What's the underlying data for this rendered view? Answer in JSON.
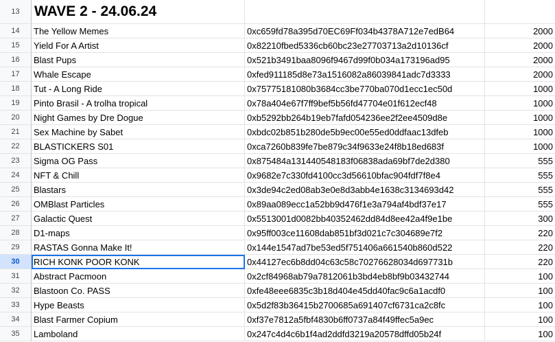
{
  "header": {
    "row_number": "13",
    "title": "WAVE 2 - 24.06.24"
  },
  "selection": {
    "active_row_number": "30"
  },
  "rows": [
    {
      "n": "14",
      "name": "The Yellow Memes",
      "address": "0xc659fd78a395d70EC69Ff034b4378A712e7edB64",
      "amount": "2000"
    },
    {
      "n": "15",
      "name": "Yield For A Artist",
      "address": "0x82210fbed5336cb60bc23e27703713a2d10136cf",
      "amount": "2000"
    },
    {
      "n": "16",
      "name": "Blast Pups",
      "address": "0x521b3491baa8096f9467d99f0b034a173196ad95",
      "amount": "2000"
    },
    {
      "n": "17",
      "name": "Whale Escape",
      "address": "0xfed911185d8e73a1516082a86039841adc7d3333",
      "amount": "2000"
    },
    {
      "n": "18",
      "name": "Tut - A Long Ride",
      "address": "0x75775181080b3684cc3be770ba070d1ecc1ec50d",
      "amount": "1000"
    },
    {
      "n": "19",
      "name": "Pinto Brasil - A trolha tropical",
      "address": "0x78a404e67f7ff9bef5b56fd47704e01f612ecf48",
      "amount": "1000"
    },
    {
      "n": "20",
      "name": "Night Games by Dre Dogue",
      "address": "0xb5292bb264b19eb7fafd054236ee2f2ee4509d8e",
      "amount": "1000"
    },
    {
      "n": "21",
      "name": "Sex Machine by Sabet",
      "address": "0xbdc02b851b280de5b9ec00e55ed0ddfaac13dfeb",
      "amount": "1000"
    },
    {
      "n": "22",
      "name": "BLASTICKERS S01",
      "address": "0xca7260b839fe7be879c34f9633e24f8b18ed683f",
      "amount": "1000"
    },
    {
      "n": "23",
      "name": "Sigma OG Pass",
      "address": "0x875484a131440548183f06838ada69bf7de2d380",
      "amount": "555"
    },
    {
      "n": "24",
      "name": "NFT & Chill",
      "address": "0x9682e7c330fd4100cc3d56610bfac904fdf7f8e4",
      "amount": "555"
    },
    {
      "n": "25",
      "name": "Blastars",
      "address": "0x3de94c2ed08ab3e0e8d3abb4e1638c3134693d42",
      "amount": "555"
    },
    {
      "n": "26",
      "name": "OMBlast Particles",
      "address": "0x89aa089ecc1a52bb9d476f1e3a794af4bdf37e17",
      "amount": "555"
    },
    {
      "n": "27",
      "name": "Galactic Quest",
      "address": "0x5513001d0082bb40352462dd84d8ee42a4f9e1be",
      "amount": "300"
    },
    {
      "n": "28",
      "name": "D1-maps",
      "address": "0x95ff003ce11608dab851bf3d021c7c304689e7f2",
      "amount": "220"
    },
    {
      "n": "29",
      "name": "RASTAS Gonna Make It!",
      "address": "0x144e1547ad7be53ed5f751406a661540b860d522",
      "amount": "220"
    },
    {
      "n": "30",
      "name": "RICH KONK POOR KONK",
      "address": "0x44127ec6b8dd04c63c58c70276628034d697731b",
      "amount": "220"
    },
    {
      "n": "31",
      "name": "Abstract Pacmoon",
      "address": "0x2cf84968ab79a7812061b3bd4eb8bf9b03432744",
      "amount": "100"
    },
    {
      "n": "32",
      "name": "Blastoon Co. PASS",
      "address": "0xfe48eee6835c3b18d404e45dd40fac9c6a1acdf0",
      "amount": "100"
    },
    {
      "n": "33",
      "name": "Hype Beasts",
      "address": "0x5d2f83b36415b2700685a691407cf6731ca2c8fc",
      "amount": "100"
    },
    {
      "n": "34",
      "name": "Blast Farmer Copium",
      "address": "0xf37e7812a5fbf4830b6ff0737a84f49ffec5a9ec",
      "amount": "100"
    },
    {
      "n": "35",
      "name": "Lamboland",
      "address": "0x247c4d4c6b1f4ad2ddfd3219a20578dffd05b24f",
      "amount": "100"
    }
  ]
}
